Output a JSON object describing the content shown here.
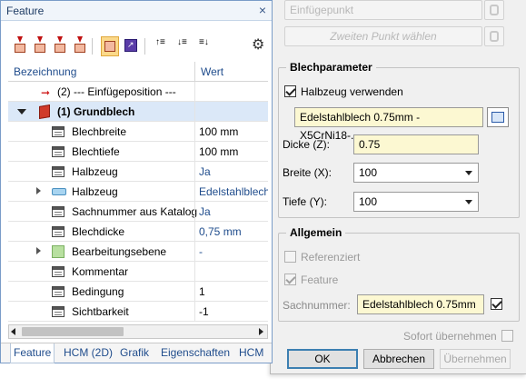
{
  "dialog": {
    "einfuegepunkt_button": "Einfügepunkt",
    "zweiten_punkt_button": "Zweiten Punkt wählen",
    "blechparameter": {
      "title": "Blechparameter",
      "halbzeug_verwenden_label": "Halbzeug verwenden",
      "halbzeug_value": "Edelstahlblech 0.75mm - X5CrNi18-...",
      "dicke_label": "Dicke (Z):",
      "dicke_value": "0.75",
      "breite_label": "Breite (X):",
      "breite_value": "100",
      "tiefe_label": "Tiefe (Y):",
      "tiefe_value": "100"
    },
    "allgemein": {
      "title": "Allgemein",
      "referenziert_label": "Referenziert",
      "feature_label": "Feature",
      "sachnummer_label": "Sachnummer:",
      "sachnummer_value": "Edelstahlblech 0.75mm"
    },
    "sofort_label": "Sofort übernehmen",
    "buttons": {
      "ok": "OK",
      "abbrechen": "Abbrechen",
      "uebernehmen": "Übernehmen"
    }
  },
  "panel": {
    "title": "Feature",
    "close_glyph": "×",
    "header": {
      "name": "Bezeichnung",
      "value": "Wert"
    },
    "rows": [
      {
        "name": "(2) --- Einfügeposition ---",
        "value": ""
      },
      {
        "name": "(1) Grundblech",
        "value": ""
      },
      {
        "name": "Blechbreite",
        "value": "100 mm"
      },
      {
        "name": "Blechtiefe",
        "value": "100 mm"
      },
      {
        "name": "Halbzeug",
        "value": "Ja"
      },
      {
        "name": "Halbzeug",
        "value": "Edelstahlblech"
      },
      {
        "name": "Sachnummer aus Katalog",
        "value": "Ja"
      },
      {
        "name": "Blechdicke",
        "value": "0,75 mm"
      },
      {
        "name": "Bearbeitungsebene",
        "value": "-"
      },
      {
        "name": "Kommentar",
        "value": ""
      },
      {
        "name": "Bedingung",
        "value": "1"
      },
      {
        "name": "Sichtbarkeit",
        "value": "-1"
      }
    ],
    "tabs": [
      "Feature",
      "HCM (2D)",
      "Grafik",
      "Eigenschaften",
      "HCM"
    ]
  }
}
